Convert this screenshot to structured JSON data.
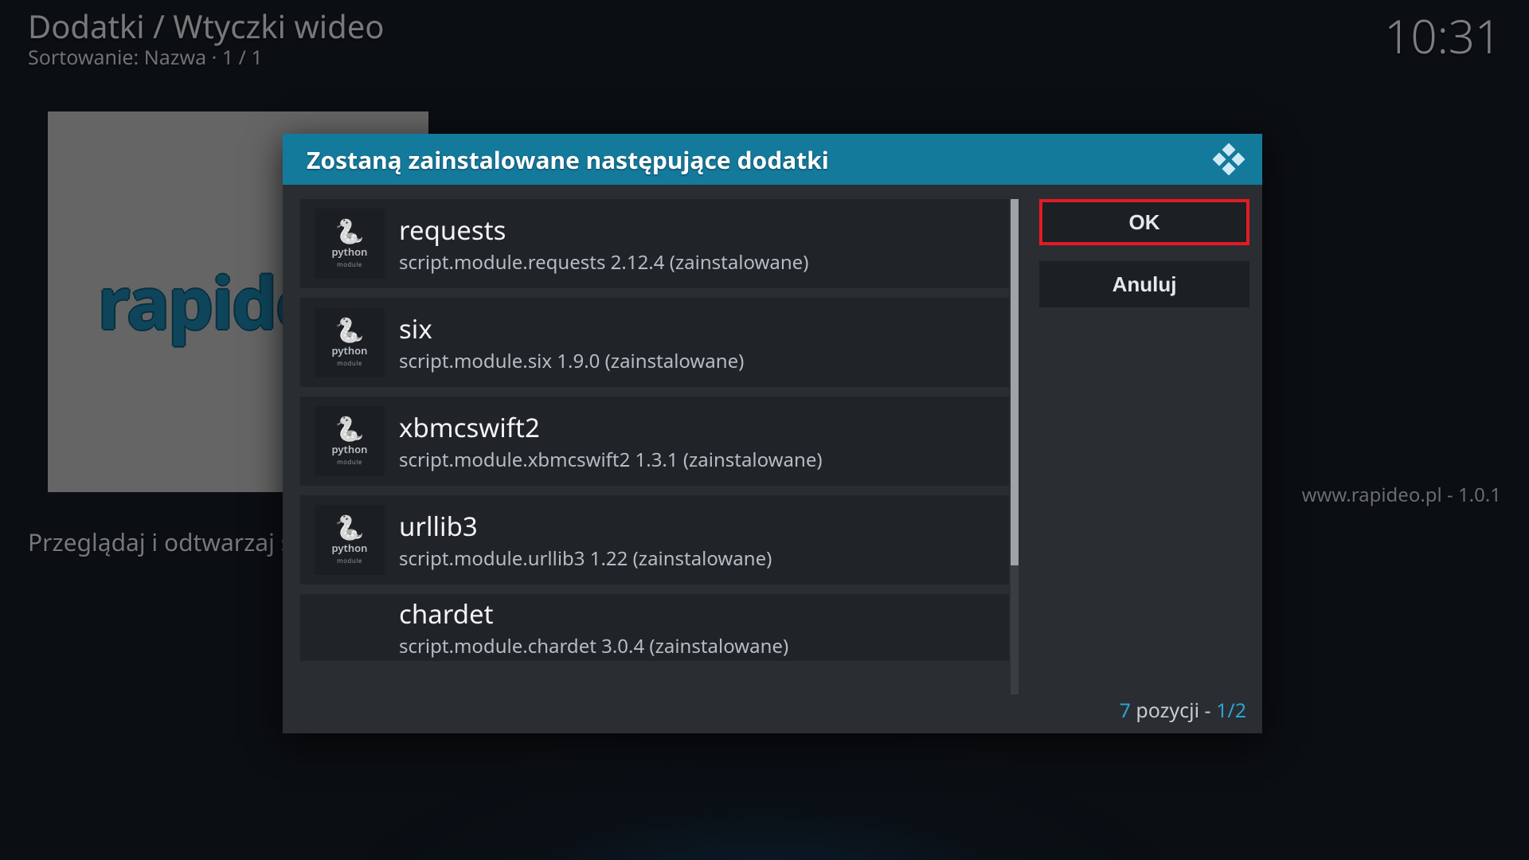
{
  "background": {
    "breadcrumb": "Dodatki / Wtyczki wideo",
    "sort_line": "Sortowanie: Nazwa  ·  1 / 1",
    "clock": "10:31",
    "tile_brand": "rapideo.",
    "description": "Przeglądaj i odtwarzaj swoje pliki z serwisu rapideo.pl",
    "meta_right": "www.rapideo.pl - 1.0.1"
  },
  "dialog": {
    "title": "Zostaną zainstalowane następujące dodatki",
    "ok_label": "OK",
    "cancel_label": "Anuluj",
    "footer_count_prefix": "7",
    "footer_count_word": " pozycji - ",
    "footer_page": "1/2",
    "items": [
      {
        "name": "requests",
        "sub": "script.module.requests 2.12.4 (zainstalowane)"
      },
      {
        "name": "six",
        "sub": "script.module.six 1.9.0 (zainstalowane)"
      },
      {
        "name": "xbmcswift2",
        "sub": "script.module.xbmcswift2 1.3.1 (zainstalowane)"
      },
      {
        "name": "urllib3",
        "sub": "script.module.urllib3 1.22 (zainstalowane)"
      },
      {
        "name": "chardet",
        "sub": "script.module.chardet 3.0.4 (zainstalowane)"
      }
    ],
    "thumb_label": "python",
    "thumb_sub": "module"
  }
}
